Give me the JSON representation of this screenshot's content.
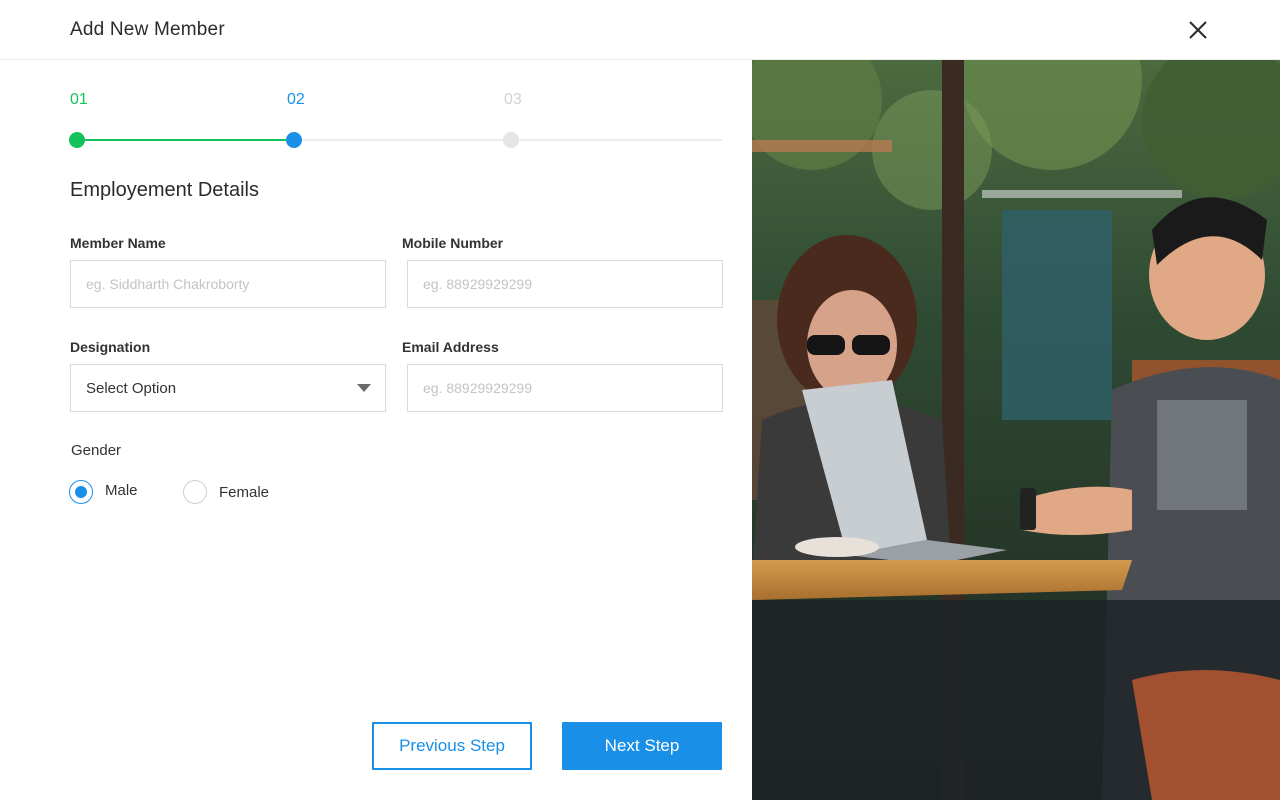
{
  "header": {
    "title": "Add New Member"
  },
  "stepper": {
    "steps": [
      {
        "number": "01",
        "status": "completed"
      },
      {
        "number": "02",
        "status": "active"
      },
      {
        "number": "03",
        "status": "upcoming"
      }
    ],
    "colors": {
      "completed": "#14c25b",
      "active": "#1a8fe8",
      "upcoming": "#cfd3d6"
    }
  },
  "form": {
    "section_title": "Employement Details",
    "member_name": {
      "label": "Member Name",
      "value": "",
      "placeholder": "eg. Siddharth Chakroborty"
    },
    "mobile_number": {
      "label": "Mobile Number",
      "value": "",
      "placeholder": "eg. 88929929299"
    },
    "designation": {
      "label": "Designation",
      "selected": "Select Option"
    },
    "email_address": {
      "label": "Email Address",
      "value": "",
      "placeholder": "eg. 88929929299"
    },
    "gender": {
      "label": "Gender",
      "options": [
        {
          "label": "Male",
          "checked": true
        },
        {
          "label": "Female",
          "checked": false
        }
      ]
    }
  },
  "actions": {
    "previous_label": "Previous Step",
    "next_label": "Next Step"
  },
  "photo": {
    "icon": "photo-illustration"
  },
  "colors": {
    "accent": "#1a8fe8",
    "success": "#14c25b"
  }
}
